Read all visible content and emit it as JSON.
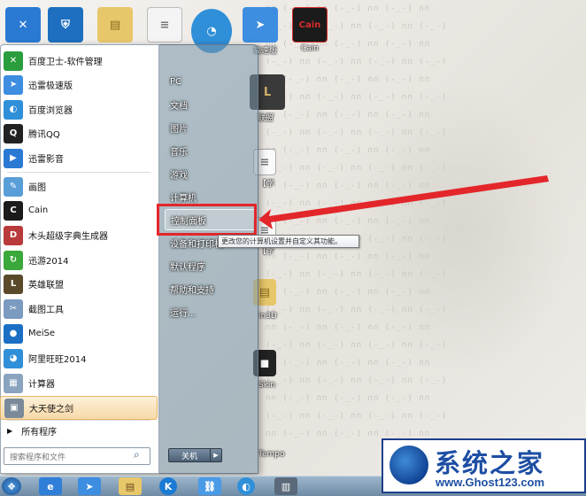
{
  "desktop": {
    "icons": [
      {
        "name": "baidu-guard-icon",
        "glyph": "✕",
        "color": "#2a7ad4"
      },
      {
        "name": "shield-icon",
        "glyph": "⛨",
        "color": "#1e6fbf"
      },
      {
        "name": "folder-icon",
        "glyph": "▤",
        "color": "#e8c76a"
      },
      {
        "name": "document-icon",
        "glyph": "≡",
        "color": "#dcdcdc"
      },
      {
        "name": "control-panel-icon",
        "glyph": "◔",
        "color": "#2f8fd8"
      },
      {
        "name": "thunder-icon",
        "glyph": "➤",
        "color": "#3d8de0"
      },
      {
        "name": "cain-icon",
        "glyph": "Cain",
        "color": "#1b1b1b"
      }
    ],
    "labels": {
      "thunder": "载速版",
      "cain": "Cain",
      "league": "联盟",
      "shudu": "【学",
      "zixue": "【学",
      "d3d": "in3D",
      "skin": "Skin",
      "tu": "图",
      "sou": "Tempo"
    }
  },
  "start_menu": {
    "programs": [
      {
        "label": "百度卫士-软件管理",
        "icon": "baidu-guard-icon",
        "color": "#2a9d3c",
        "glyph": "✕"
      },
      {
        "label": "迅雷极速版",
        "icon": "thunder-icon",
        "color": "#3d8de0",
        "glyph": "➤"
      },
      {
        "label": "百度浏览器",
        "icon": "browser-icon",
        "color": "#2f8fd8",
        "glyph": "◐"
      },
      {
        "label": "腾讯QQ",
        "icon": "qq-icon",
        "color": "#222222",
        "glyph": "Q"
      },
      {
        "label": "迅雷影音",
        "icon": "player-icon",
        "color": "#2a7ad4",
        "glyph": "▶"
      },
      {
        "label": "画图",
        "icon": "paint-icon",
        "color": "#5a9ed8",
        "glyph": "✎"
      },
      {
        "label": "Cain",
        "icon": "cain-icon",
        "color": "#1b1b1b",
        "glyph": "C"
      },
      {
        "label": "木头超级字典生成器",
        "icon": "dictionary-icon",
        "color": "#b83a3a",
        "glyph": "D"
      },
      {
        "label": "迅游2014",
        "icon": "game-accelerator-icon",
        "color": "#3aa83a",
        "glyph": "↻"
      },
      {
        "label": "英雄联盟",
        "icon": "league-icon",
        "color": "#5a4a2a",
        "glyph": "L"
      },
      {
        "label": "截图工具",
        "icon": "scissors-icon",
        "color": "#7a9ac0",
        "glyph": "✂"
      },
      {
        "label": "MeiSe",
        "icon": "meise-icon",
        "color": "#1a6fc4",
        "glyph": "●"
      },
      {
        "label": "阿里旺旺2014",
        "icon": "wangwang-icon",
        "color": "#2f8fd8",
        "glyph": "◕"
      },
      {
        "label": "计算器",
        "icon": "calculator-icon",
        "color": "#8aa4c0",
        "glyph": "▦"
      },
      {
        "label": "大天使之剑",
        "icon": "game-icon",
        "color": "#7a8a9a",
        "glyph": "▣"
      }
    ],
    "all_programs": "所有程序",
    "search_placeholder": "搜索程序和文件",
    "right_items": [
      {
        "label": "PC",
        "name": "right-item-pc"
      },
      {
        "label": "文档",
        "name": "right-item-documents"
      },
      {
        "label": "图片",
        "name": "right-item-pictures"
      },
      {
        "label": "音乐",
        "name": "right-item-music"
      },
      {
        "label": "游戏",
        "name": "right-item-games"
      },
      {
        "label": "计算机",
        "name": "right-item-computer"
      },
      {
        "label": "控制面板",
        "name": "right-item-control-panel"
      },
      {
        "label": "设备和打印机",
        "name": "right-item-devices-printers"
      },
      {
        "label": "默认程序",
        "name": "right-item-default-programs"
      },
      {
        "label": "帮助和支持",
        "name": "right-item-help-support"
      },
      {
        "label": "运行...",
        "name": "right-item-run"
      }
    ],
    "tooltip": "更改您的计算机设置并自定义其功能。",
    "shutdown": "关机"
  },
  "colors": {
    "annotation": "#e3262a",
    "logo_blue": "#1d4ea3"
  },
  "logo": {
    "title": "系统之家",
    "url": "www.Ghost123.com"
  }
}
